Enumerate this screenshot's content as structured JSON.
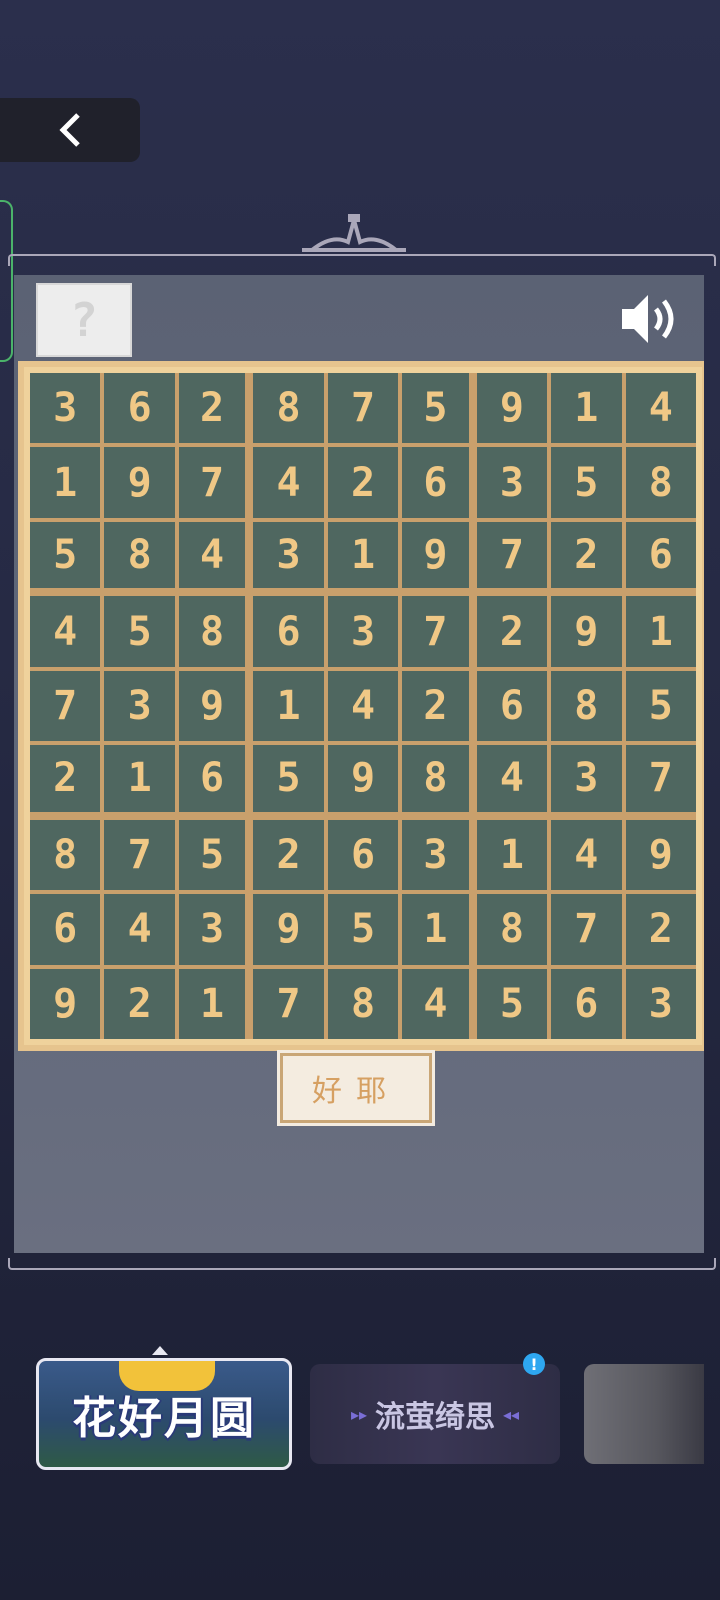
{
  "header": {
    "back_icon": "chevron-left-icon"
  },
  "toolbar": {
    "help_label": "?",
    "sound_icon": "speaker-icon"
  },
  "sudoku": {
    "rows": [
      [
        "3",
        "6",
        "2",
        "8",
        "7",
        "5",
        "9",
        "1",
        "4"
      ],
      [
        "1",
        "9",
        "7",
        "4",
        "2",
        "6",
        "3",
        "5",
        "8"
      ],
      [
        "5",
        "8",
        "4",
        "3",
        "1",
        "9",
        "7",
        "2",
        "6"
      ],
      [
        "4",
        "5",
        "8",
        "6",
        "3",
        "7",
        "2",
        "9",
        "1"
      ],
      [
        "7",
        "3",
        "9",
        "1",
        "4",
        "2",
        "6",
        "8",
        "5"
      ],
      [
        "2",
        "1",
        "6",
        "5",
        "9",
        "8",
        "4",
        "3",
        "7"
      ],
      [
        "8",
        "7",
        "5",
        "2",
        "6",
        "3",
        "1",
        "4",
        "9"
      ],
      [
        "6",
        "4",
        "3",
        "9",
        "5",
        "1",
        "8",
        "7",
        "2"
      ],
      [
        "9",
        "2",
        "1",
        "7",
        "8",
        "4",
        "5",
        "6",
        "3"
      ]
    ]
  },
  "confirm": {
    "label": "好耶"
  },
  "banners": [
    {
      "title": "花好月圆"
    },
    {
      "title": "流萤绮思"
    },
    {
      "title": ""
    }
  ],
  "colors": {
    "digit": "#f0c886",
    "board_border": "#e6c48e"
  }
}
